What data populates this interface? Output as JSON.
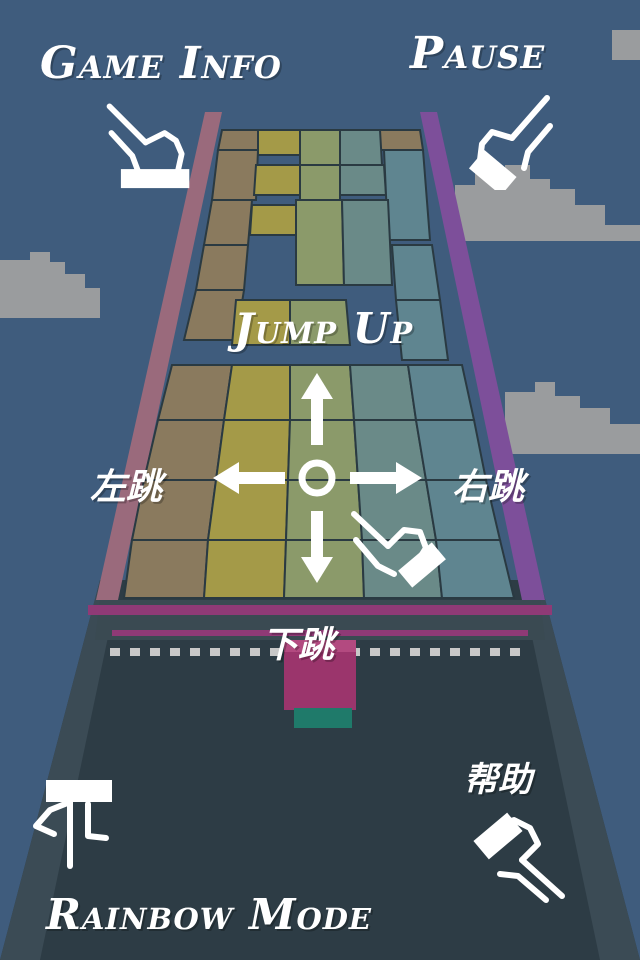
{
  "colors": {
    "sky": "#3f5c7d",
    "cloud": "#9a9c9e",
    "road": "#2d3c45",
    "player": "#9b356c",
    "overlay": "#ffffff"
  },
  "labels": {
    "game_info": "Game Info",
    "pause": "Pause",
    "jump_up": "Jump Up",
    "jump_left": "左跳",
    "jump_right": "右跳",
    "jump_down": "下跳",
    "help": "帮助",
    "rainbow_mode": "Rainbow Mode"
  },
  "icons": {
    "game_info": "pointing-hand-icon",
    "pause": "pointing-hand-icon",
    "help": "pointing-hand-icon",
    "rainbow_mode": "pointing-hand-icon",
    "swipe": "swipe-hand-icon",
    "directions": "four-direction-arrows-icon"
  }
}
